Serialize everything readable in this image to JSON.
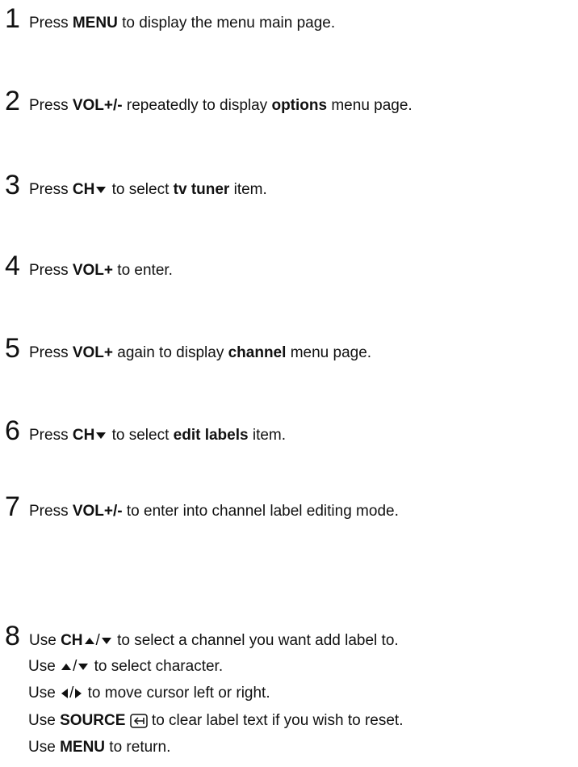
{
  "steps": [
    {
      "num": "1",
      "pre": "Press ",
      "b1": "MENU",
      "mid": " to display the menu main page.",
      "b2": "",
      "post": ""
    },
    {
      "num": "2",
      "pre": "Press ",
      "b1": "VOL+/-",
      "mid": " repeatedly to display ",
      "b2": "options",
      "post": " menu page."
    },
    {
      "num": "3",
      "pre": "Press ",
      "b1": "CH",
      "mid": " to select ",
      "b2": "tv tuner",
      "post": " item."
    },
    {
      "num": "4",
      "pre": "Press ",
      "b1": "VOL+",
      "mid": " to enter.",
      "b2": "",
      "post": ""
    },
    {
      "num": "5",
      "pre": "Press ",
      "b1": "VOL+",
      "mid": " again to display ",
      "b2": "channel",
      "post": " menu page."
    },
    {
      "num": "6",
      "pre": "Press ",
      "b1": "CH",
      "mid": " to select ",
      "b2": "edit labels",
      "post": " item."
    },
    {
      "num": "7",
      "pre": "Press ",
      "b1": "VOL+/-",
      "mid": " to enter into channel label editing mode.",
      "b2": "",
      "post": ""
    }
  ],
  "step8": {
    "num": "8",
    "line1_pre": "Use ",
    "line1_b": "CH",
    "line1_sep": "/",
    "line1_post": "  to select a channel you want add label to.",
    "line2_pre": "Use ",
    "line2_sep": "/",
    "line2_post": " to select character.",
    "line3_pre": "Use ",
    "line3_sep": "/",
    "line3_post": " to move cursor left or right.",
    "line4_pre": "Use ",
    "line4_b": "SOURCE",
    "line4_post": "  to clear label text if you wish to reset.",
    "line5_pre": "Use ",
    "line5_b": "MENU",
    "line5_post": " to return."
  },
  "icons": [
    "triangle-down-icon",
    "triangle-up-icon",
    "triangle-left-icon",
    "triangle-right-icon",
    "source-input-icon"
  ]
}
